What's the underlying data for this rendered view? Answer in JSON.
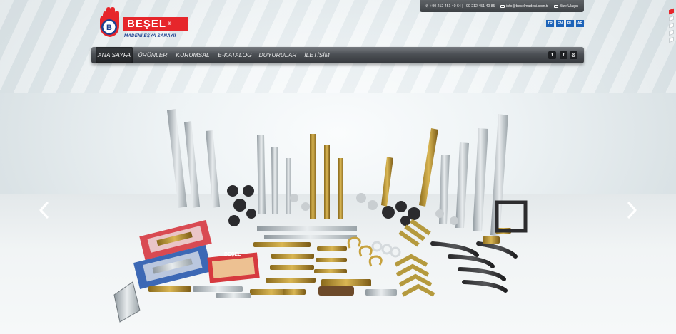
{
  "contact": {
    "phones": "+90 212 451 40 64 | +90 212 451 40 85",
    "email": "info@beselmadeni.com.tr",
    "contact_link": "Bize Ulaşın"
  },
  "brand": {
    "name": "BEŞEL",
    "registered": "®",
    "tagline": "MADENİ EŞYA SANAYİİ",
    "logo_color": "#e6262b",
    "tagline_color": "#1c3f8f"
  },
  "languages": [
    "TR",
    "EN",
    "RU",
    "AR"
  ],
  "nav": {
    "items": [
      "ANA SAYFA",
      "ÜRÜNLER",
      "KURUMSAL",
      "E-KATALOG",
      "DUYURULAR",
      "İLETİŞİM"
    ],
    "active": "ANA SAYFA"
  },
  "social": {
    "facebook": "f",
    "twitter": "t",
    "instagram": "◎"
  },
  "slider": {
    "prev_icon": "chevron-left-icon",
    "next_icon": "chevron-right-icon",
    "slide_count": 5,
    "active_slide": 1,
    "package_label": "BEŞEL"
  }
}
